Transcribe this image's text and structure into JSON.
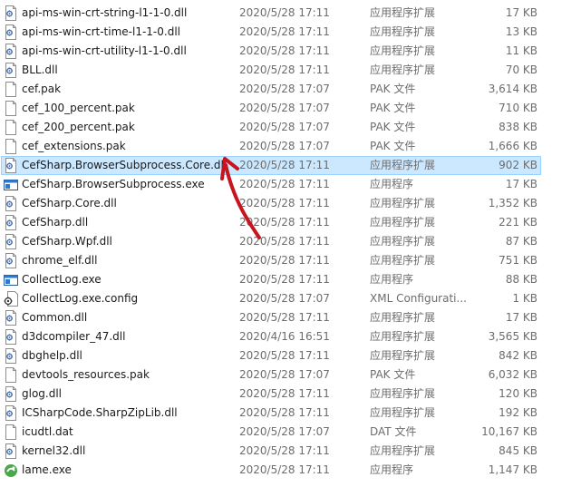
{
  "accent": "#cce8ff",
  "annotation_color": "#c8141e",
  "files": [
    {
      "name": "api-ms-win-crt-string-l1-1-0.dll",
      "date": "2020/5/28 17:11",
      "type": "应用程序扩展",
      "size": "17 KB",
      "icon": "dll-gear-icon"
    },
    {
      "name": "api-ms-win-crt-time-l1-1-0.dll",
      "date": "2020/5/28 17:11",
      "type": "应用程序扩展",
      "size": "13 KB",
      "icon": "dll-gear-icon"
    },
    {
      "name": "api-ms-win-crt-utility-l1-1-0.dll",
      "date": "2020/5/28 17:11",
      "type": "应用程序扩展",
      "size": "11 KB",
      "icon": "dll-gear-icon"
    },
    {
      "name": "BLL.dll",
      "date": "2020/5/28 17:11",
      "type": "应用程序扩展",
      "size": "70 KB",
      "icon": "dll-gear-icon"
    },
    {
      "name": "cef.pak",
      "date": "2020/5/28 17:07",
      "type": "PAK 文件",
      "size": "3,614 KB",
      "icon": "blank-file-icon"
    },
    {
      "name": "cef_100_percent.pak",
      "date": "2020/5/28 17:07",
      "type": "PAK 文件",
      "size": "710 KB",
      "icon": "blank-file-icon"
    },
    {
      "name": "cef_200_percent.pak",
      "date": "2020/5/28 17:07",
      "type": "PAK 文件",
      "size": "838 KB",
      "icon": "blank-file-icon"
    },
    {
      "name": "cef_extensions.pak",
      "date": "2020/5/28 17:07",
      "type": "PAK 文件",
      "size": "1,666 KB",
      "icon": "blank-file-icon"
    },
    {
      "name": "CefSharp.BrowserSubprocess.Core.dll",
      "date": "2020/5/28 17:11",
      "type": "应用程序扩展",
      "size": "902 KB",
      "icon": "dll-gear-icon",
      "selected": true
    },
    {
      "name": "CefSharp.BrowserSubprocess.exe",
      "date": "2020/5/28 17:11",
      "type": "应用程序",
      "size": "17 KB",
      "icon": "exe-window-icon"
    },
    {
      "name": "CefSharp.Core.dll",
      "date": "2020/5/28 17:11",
      "type": "应用程序扩展",
      "size": "1,352 KB",
      "icon": "dll-gear-icon"
    },
    {
      "name": "CefSharp.dll",
      "date": "2020/5/28 17:11",
      "type": "应用程序扩展",
      "size": "221 KB",
      "icon": "dll-gear-icon"
    },
    {
      "name": "CefSharp.Wpf.dll",
      "date": "2020/5/28 17:11",
      "type": "应用程序扩展",
      "size": "87 KB",
      "icon": "dll-gear-icon"
    },
    {
      "name": "chrome_elf.dll",
      "date": "2020/5/28 17:11",
      "type": "应用程序扩展",
      "size": "751 KB",
      "icon": "dll-gear-icon"
    },
    {
      "name": "CollectLog.exe",
      "date": "2020/5/28 17:11",
      "type": "应用程序",
      "size": "88 KB",
      "icon": "exe-window-icon"
    },
    {
      "name": "CollectLog.exe.config",
      "date": "2020/5/28 17:07",
      "type": "XML Configurati...",
      "size": "1 KB",
      "icon": "config-gear-icon"
    },
    {
      "name": "Common.dll",
      "date": "2020/5/28 17:11",
      "type": "应用程序扩展",
      "size": "17 KB",
      "icon": "dll-gear-icon"
    },
    {
      "name": "d3dcompiler_47.dll",
      "date": "2020/4/16 16:51",
      "type": "应用程序扩展",
      "size": "3,565 KB",
      "icon": "dll-gear-icon"
    },
    {
      "name": "dbghelp.dll",
      "date": "2020/5/28 17:11",
      "type": "应用程序扩展",
      "size": "842 KB",
      "icon": "dll-gear-icon"
    },
    {
      "name": "devtools_resources.pak",
      "date": "2020/5/28 17:07",
      "type": "PAK 文件",
      "size": "6,032 KB",
      "icon": "blank-file-icon"
    },
    {
      "name": "glog.dll",
      "date": "2020/5/28 17:11",
      "type": "应用程序扩展",
      "size": "120 KB",
      "icon": "dll-gear-icon"
    },
    {
      "name": "ICSharpCode.SharpZipLib.dll",
      "date": "2020/5/28 17:11",
      "type": "应用程序扩展",
      "size": "192 KB",
      "icon": "dll-gear-icon"
    },
    {
      "name": "icudtl.dat",
      "date": "2020/5/28 17:07",
      "type": "DAT 文件",
      "size": "10,167 KB",
      "icon": "blank-file-icon"
    },
    {
      "name": "kernel32.dll",
      "date": "2020/5/28 17:11",
      "type": "应用程序扩展",
      "size": "845 KB",
      "icon": "dll-gear-icon"
    },
    {
      "name": "lame.exe",
      "date": "2020/5/28 17:11",
      "type": "应用程序",
      "size": "1,147 KB",
      "icon": "lame-app-icon"
    }
  ]
}
